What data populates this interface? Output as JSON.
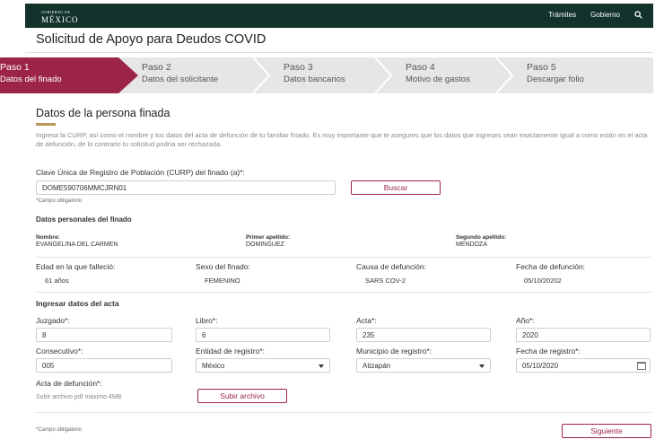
{
  "header": {
    "logo_small": "GOBIERNO DE",
    "logo_main": "MÉXICO",
    "nav": [
      "Trámites",
      "Gobierno"
    ],
    "search_icon": "search-icon"
  },
  "page_title": "Solicitud de Apoyo para Deudos COVID",
  "steps": [
    {
      "number": "Paso 1",
      "label": "Datos del finado"
    },
    {
      "number": "Paso 2",
      "label": "Datos del solicitante"
    },
    {
      "number": "Paso 3",
      "label": "Datos bancarios"
    },
    {
      "number": "Paso 4",
      "label": "Motivo de gastos"
    },
    {
      "number": "Paso 5",
      "label": "Descargar folio"
    }
  ],
  "section": {
    "title": "Datos de la persona finada",
    "intro": "Ingresa la CURP, así como el nombre y los datos del acta de defunción de tu familiar finado. Es muy importante que te asegures que los datos que ingreses sean exactamente igual a como están en el acta de defunción, de lo contrario tu solicitud podría ser rechazada."
  },
  "curp": {
    "label": "Clave Única de Registro de Población (CURP) del finado (a)*:",
    "value": "DOME590706MMCJRN01",
    "hint": "*Campo obligatorio",
    "search_button": "Buscar"
  },
  "personal": {
    "title": "Datos  personales del finado",
    "nombre_label": "Nombre:",
    "nombre": "EVANGELINA DEL CARMEN",
    "primer_label": "Primer apellido:",
    "primer": "DOMINGUEZ",
    "segundo_label": "Segundo apellido:",
    "segundo": "MENDOZA",
    "edad_label": "Edad en la que falleció:",
    "edad": "61 años",
    "sexo_label": "Sexo del finado:",
    "sexo": "FEMENINO",
    "causa_label": "Causa de defunción:",
    "causa": "SARS COV-2",
    "fecha_label": "Fecha de defunción:",
    "fecha": "05/10/20202"
  },
  "acta": {
    "title": "Ingresar datos del acta",
    "juzgado_label": "Juzgado*:",
    "juzgado": "8",
    "libro_label": "Libro*:",
    "libro": "6",
    "acta_label": "Acta*:",
    "acta": "235",
    "anio_label": "Año*:",
    "anio": "2020",
    "consecutivo_label": "Consecutivo*:",
    "consecutivo": "005",
    "entidad_label": "Entidad de registro*:",
    "entidad": "México",
    "municipio_label": "Municipio de registro*:",
    "municipio": "Atizapán",
    "fecha_reg_label": "Fecha de registro*:",
    "fecha_reg": "05/10/2020",
    "acta_def_label": "Acta de defunción*:",
    "acta_def_hint": "Subir archivo pdf máximo 4MB",
    "upload_button": "Subir archivo"
  },
  "footer": {
    "hint": "*Campo obligatorio",
    "next_button": "Siguiente"
  },
  "colors": {
    "primary": "#9d2449",
    "header_bg": "#13322b",
    "accent_gold": "#bc955c",
    "steps_bg": "#e6e6e6"
  }
}
